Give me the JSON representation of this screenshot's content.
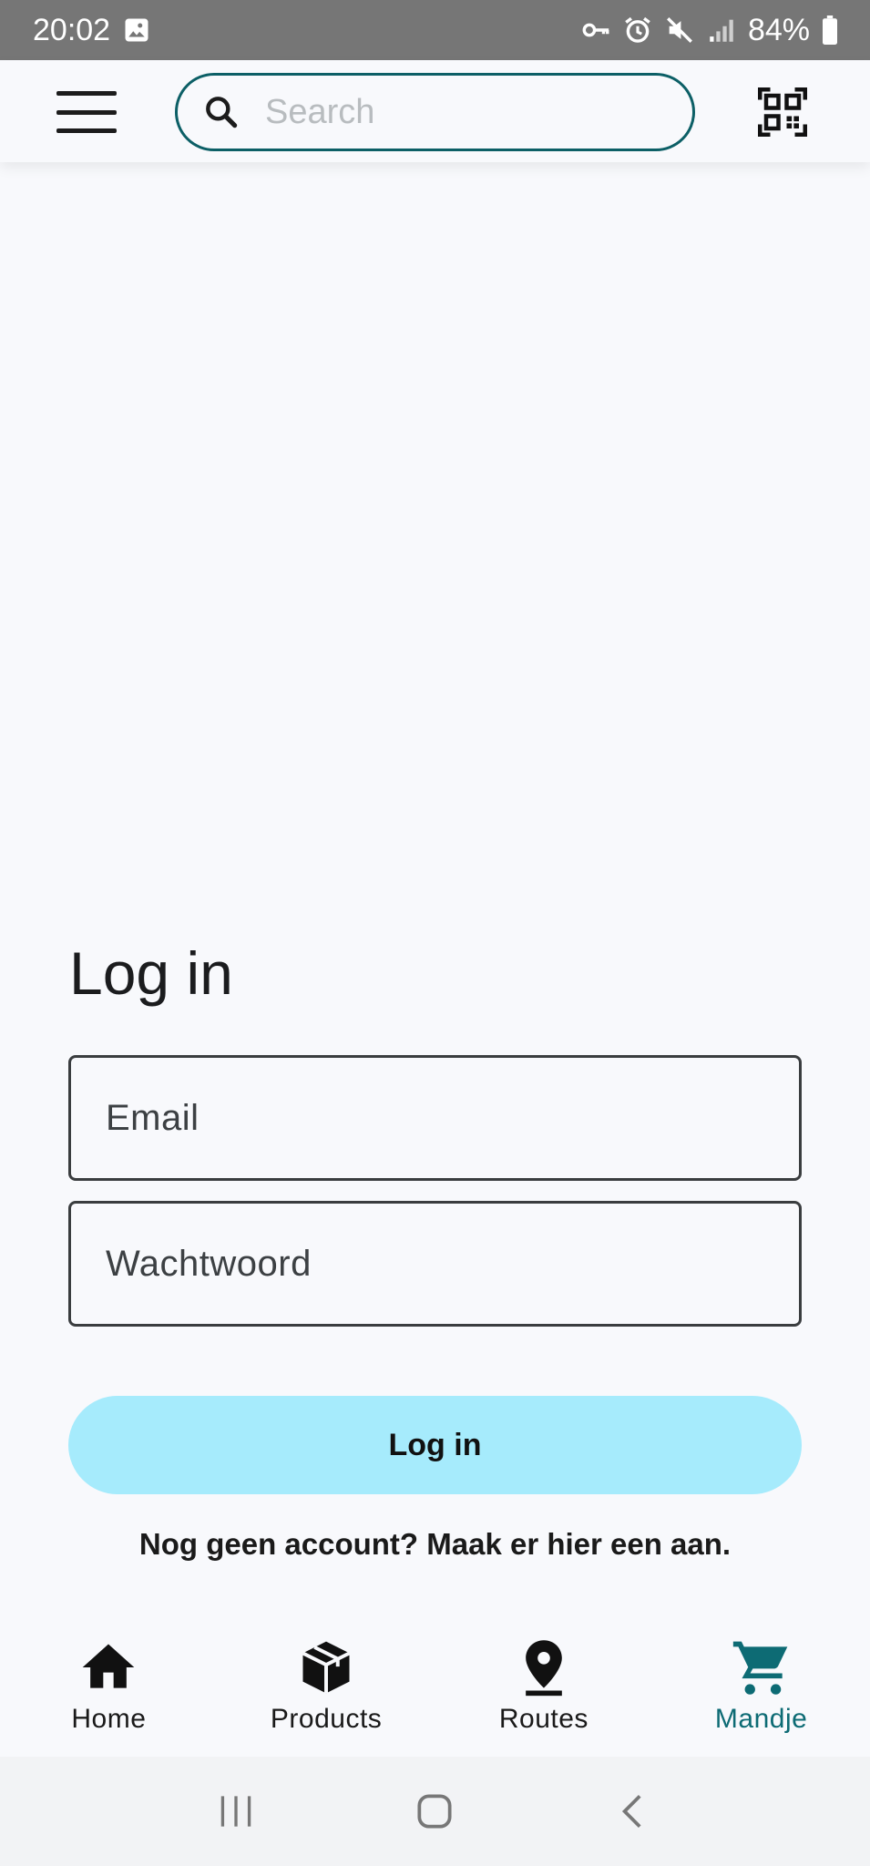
{
  "status_bar": {
    "time": "20:02",
    "battery": "84%",
    "icons": [
      "image-icon",
      "vpn-key-icon",
      "alarm-icon",
      "mute-icon",
      "signal-icon",
      "battery-icon"
    ]
  },
  "top_bar": {
    "search_placeholder": "Search",
    "icons": [
      "menu-icon",
      "search-icon",
      "qr-code-icon"
    ]
  },
  "login": {
    "title": "Log in",
    "email_placeholder": "Email",
    "password_placeholder": "Wachtwoord",
    "button_label": "Log in",
    "register_text": "Nog geen account? Maak er hier een aan."
  },
  "bottom_nav": {
    "items": [
      {
        "label": "Home",
        "icon": "home-icon",
        "active": false
      },
      {
        "label": "Products",
        "icon": "package-icon",
        "active": false
      },
      {
        "label": "Routes",
        "icon": "location-pin-icon",
        "active": false
      },
      {
        "label": "Mandje",
        "icon": "cart-icon",
        "active": true
      }
    ],
    "active_color": "#0d6b74"
  },
  "system_nav": [
    "recents-icon",
    "home-circle-icon",
    "back-icon"
  ],
  "colors": {
    "accent": "#0c5f66",
    "button_bg": "#a6ebfc",
    "background": "#f8f9fc"
  }
}
